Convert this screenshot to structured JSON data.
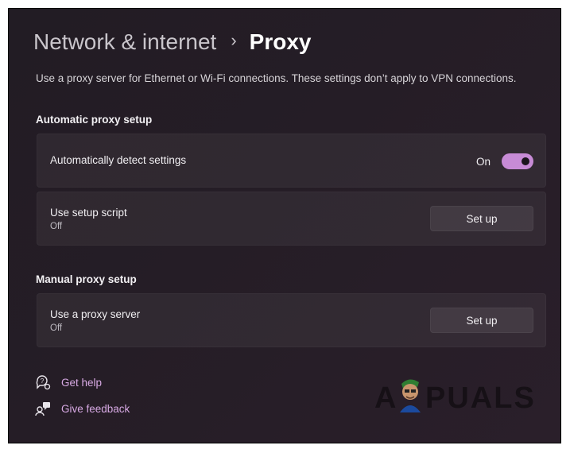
{
  "breadcrumb": {
    "parent": "Network & internet",
    "separator": "›",
    "current": "Proxy"
  },
  "description": "Use a proxy server for Ethernet or Wi-Fi connections. These settings don’t apply to VPN connections.",
  "automatic": {
    "title": "Automatic proxy setup",
    "detect": {
      "label": "Automatically detect settings",
      "state_text": "On",
      "enabled": true
    },
    "script": {
      "label": "Use setup script",
      "status": "Off",
      "button": "Set up"
    }
  },
  "manual": {
    "title": "Manual proxy setup",
    "proxy": {
      "label": "Use a proxy server",
      "status": "Off",
      "button": "Set up"
    }
  },
  "links": {
    "help": {
      "label": "Get help",
      "icon": "help-icon"
    },
    "feedback": {
      "label": "Give feedback",
      "icon": "feedback-icon"
    }
  },
  "watermark": "APPUALS",
  "colors": {
    "accent": "#c78bd6",
    "link": "#d7a9e3",
    "background": "#231c25"
  }
}
